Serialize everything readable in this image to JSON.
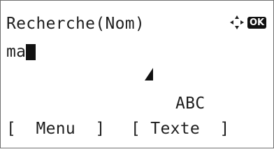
{
  "screen": {
    "title": "Recherche(Nom)",
    "input_value": "ma",
    "input_mode": "ABC",
    "nav_ok_badge": "OK"
  },
  "softkeys": {
    "menu": "[  Menu  ]",
    "text": "[ Texte  ]"
  },
  "icons": {
    "nav": "dpad-arrows-icon",
    "text_cursor": "cursor-position-triangle-icon"
  },
  "colors": {
    "background": "#ffffff",
    "text": "#1e1e1e",
    "border": "#6f6f6f"
  }
}
